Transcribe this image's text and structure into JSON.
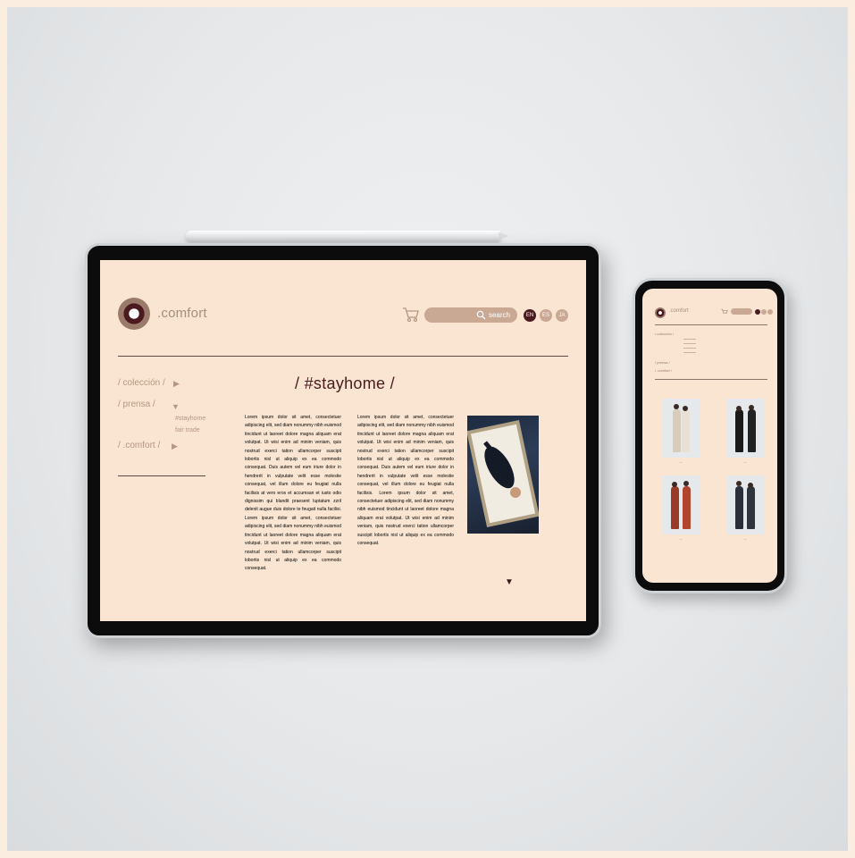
{
  "tablet": {
    "brand": ".comfort",
    "search_label": "search",
    "languages": [
      "EN",
      "ES",
      "JA"
    ],
    "nav": [
      {
        "label": "/ colección /",
        "arrow": "▶"
      },
      {
        "label": "/ prensa /",
        "arrow": "▼"
      },
      {
        "label": "/ .comfort /",
        "arrow": "▶"
      }
    ],
    "subnav": [
      "#stayhome",
      "fair trade"
    ],
    "heading": "/ #stayhome /",
    "article_col1": "Lorem ipsum dolor sit amet, consectetuer adipiscing elit, sed diam nonummy nibh euismod tincidunt ut laoreet dolore magna aliquam erat volutpat. Ut wisi enim ad minim veniam, quis nostrud exerci tation ullamcorper suscipit lobortis nisl ut aliquip ex ea commodo consequat. Duis autem vel eum iriure dolor in hendrerit in vulputate velit esse molestie consequat, vel illum dolore eu feugiat nulla facilisis at vero eros et accumsan et iusto odio dignissim qui blandit praesent luptatum zzril delenit augue duis dolore te feugait nulla facilisi. Lorem ipsum dolor sit amet, consectetuer adipiscing elit, sed diam nonummy nibh euismod tincidunt ut laoreet dolore magna aliquam erat volutpat. Ut wisi enim ad minim veniam, quis nostrud exerci tation ullamcorper suscipit lobortis nisl ut aliquip ex ea commodo consequat.",
    "article_col2": "Lorem ipsum dolor sit amet, consectetuer adipiscing elit, sed diam nonummy nibh euismod tincidunt ut laoreet dolore magna aliquam erat volutpat. Ut wisi enim ad minim veniam, quis nostrud exerci tation ullamcorper suscipit lobortis nisl ut aliquip ex ea commodo consequat. Duis autem vel eum iriure dolor in hendrerit in vulputate velit esse molestie consequat, vel illum dolore eu feugiat nulla facilisis. Lorem ipsum dolor sit amet, consectetuer adipiscing elit, sed diam nonummy nibh euismod tincidunt ut laoreet dolore magna aliquam erat volutpat. Ut wisi enim ad minim veniam, quis nostrud exerci tation ullamcorper suscipit lobortis nisl ut aliquip ex ea commodo consequat.",
    "down_arrow": "▼"
  },
  "phone": {
    "brand": ".comfort",
    "nav": [
      {
        "label": "/ colección /"
      },
      {
        "label": "/ prensa /"
      },
      {
        "label": "/ .comfort /"
      }
    ]
  },
  "colors": {
    "screen_bg": "#f9e5d1",
    "accent_dark": "#4a1a1e",
    "accent_light": "#c9a894",
    "nav_text": "#b49784"
  },
  "icons": [
    "cart-icon",
    "search-icon",
    "logo-icon",
    "chevron-right-icon",
    "chevron-down-icon"
  ]
}
